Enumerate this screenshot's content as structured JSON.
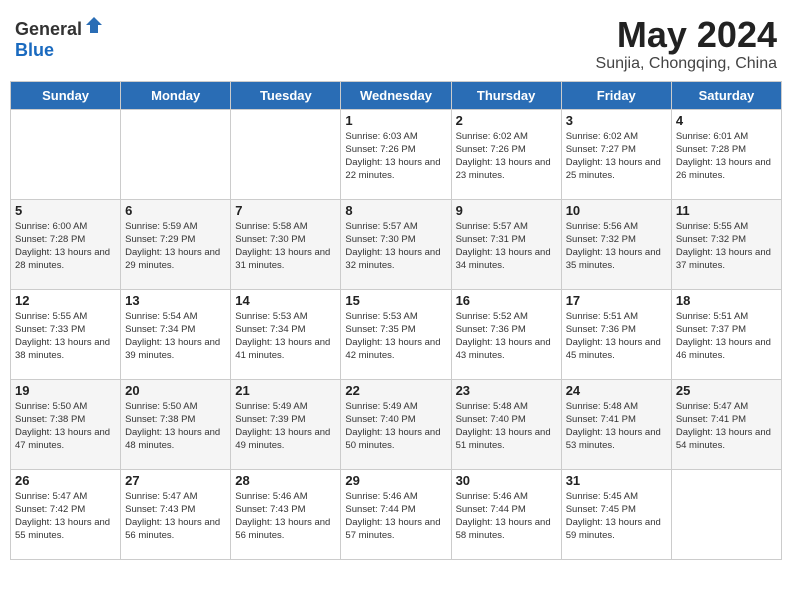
{
  "header": {
    "logo_general": "General",
    "logo_blue": "Blue",
    "month_year": "May 2024",
    "location": "Sunjia, Chongqing, China"
  },
  "weekdays": [
    "Sunday",
    "Monday",
    "Tuesday",
    "Wednesday",
    "Thursday",
    "Friday",
    "Saturday"
  ],
  "weeks": [
    [
      {
        "day": "",
        "sunrise": "",
        "sunset": "",
        "daylight": ""
      },
      {
        "day": "",
        "sunrise": "",
        "sunset": "",
        "daylight": ""
      },
      {
        "day": "",
        "sunrise": "",
        "sunset": "",
        "daylight": ""
      },
      {
        "day": "1",
        "sunrise": "Sunrise: 6:03 AM",
        "sunset": "Sunset: 7:26 PM",
        "daylight": "Daylight: 13 hours and 22 minutes."
      },
      {
        "day": "2",
        "sunrise": "Sunrise: 6:02 AM",
        "sunset": "Sunset: 7:26 PM",
        "daylight": "Daylight: 13 hours and 23 minutes."
      },
      {
        "day": "3",
        "sunrise": "Sunrise: 6:02 AM",
        "sunset": "Sunset: 7:27 PM",
        "daylight": "Daylight: 13 hours and 25 minutes."
      },
      {
        "day": "4",
        "sunrise": "Sunrise: 6:01 AM",
        "sunset": "Sunset: 7:28 PM",
        "daylight": "Daylight: 13 hours and 26 minutes."
      }
    ],
    [
      {
        "day": "5",
        "sunrise": "Sunrise: 6:00 AM",
        "sunset": "Sunset: 7:28 PM",
        "daylight": "Daylight: 13 hours and 28 minutes."
      },
      {
        "day": "6",
        "sunrise": "Sunrise: 5:59 AM",
        "sunset": "Sunset: 7:29 PM",
        "daylight": "Daylight: 13 hours and 29 minutes."
      },
      {
        "day": "7",
        "sunrise": "Sunrise: 5:58 AM",
        "sunset": "Sunset: 7:30 PM",
        "daylight": "Daylight: 13 hours and 31 minutes."
      },
      {
        "day": "8",
        "sunrise": "Sunrise: 5:57 AM",
        "sunset": "Sunset: 7:30 PM",
        "daylight": "Daylight: 13 hours and 32 minutes."
      },
      {
        "day": "9",
        "sunrise": "Sunrise: 5:57 AM",
        "sunset": "Sunset: 7:31 PM",
        "daylight": "Daylight: 13 hours and 34 minutes."
      },
      {
        "day": "10",
        "sunrise": "Sunrise: 5:56 AM",
        "sunset": "Sunset: 7:32 PM",
        "daylight": "Daylight: 13 hours and 35 minutes."
      },
      {
        "day": "11",
        "sunrise": "Sunrise: 5:55 AM",
        "sunset": "Sunset: 7:32 PM",
        "daylight": "Daylight: 13 hours and 37 minutes."
      }
    ],
    [
      {
        "day": "12",
        "sunrise": "Sunrise: 5:55 AM",
        "sunset": "Sunset: 7:33 PM",
        "daylight": "Daylight: 13 hours and 38 minutes."
      },
      {
        "day": "13",
        "sunrise": "Sunrise: 5:54 AM",
        "sunset": "Sunset: 7:34 PM",
        "daylight": "Daylight: 13 hours and 39 minutes."
      },
      {
        "day": "14",
        "sunrise": "Sunrise: 5:53 AM",
        "sunset": "Sunset: 7:34 PM",
        "daylight": "Daylight: 13 hours and 41 minutes."
      },
      {
        "day": "15",
        "sunrise": "Sunrise: 5:53 AM",
        "sunset": "Sunset: 7:35 PM",
        "daylight": "Daylight: 13 hours and 42 minutes."
      },
      {
        "day": "16",
        "sunrise": "Sunrise: 5:52 AM",
        "sunset": "Sunset: 7:36 PM",
        "daylight": "Daylight: 13 hours and 43 minutes."
      },
      {
        "day": "17",
        "sunrise": "Sunrise: 5:51 AM",
        "sunset": "Sunset: 7:36 PM",
        "daylight": "Daylight: 13 hours and 45 minutes."
      },
      {
        "day": "18",
        "sunrise": "Sunrise: 5:51 AM",
        "sunset": "Sunset: 7:37 PM",
        "daylight": "Daylight: 13 hours and 46 minutes."
      }
    ],
    [
      {
        "day": "19",
        "sunrise": "Sunrise: 5:50 AM",
        "sunset": "Sunset: 7:38 PM",
        "daylight": "Daylight: 13 hours and 47 minutes."
      },
      {
        "day": "20",
        "sunrise": "Sunrise: 5:50 AM",
        "sunset": "Sunset: 7:38 PM",
        "daylight": "Daylight: 13 hours and 48 minutes."
      },
      {
        "day": "21",
        "sunrise": "Sunrise: 5:49 AM",
        "sunset": "Sunset: 7:39 PM",
        "daylight": "Daylight: 13 hours and 49 minutes."
      },
      {
        "day": "22",
        "sunrise": "Sunrise: 5:49 AM",
        "sunset": "Sunset: 7:40 PM",
        "daylight": "Daylight: 13 hours and 50 minutes."
      },
      {
        "day": "23",
        "sunrise": "Sunrise: 5:48 AM",
        "sunset": "Sunset: 7:40 PM",
        "daylight": "Daylight: 13 hours and 51 minutes."
      },
      {
        "day": "24",
        "sunrise": "Sunrise: 5:48 AM",
        "sunset": "Sunset: 7:41 PM",
        "daylight": "Daylight: 13 hours and 53 minutes."
      },
      {
        "day": "25",
        "sunrise": "Sunrise: 5:47 AM",
        "sunset": "Sunset: 7:41 PM",
        "daylight": "Daylight: 13 hours and 54 minutes."
      }
    ],
    [
      {
        "day": "26",
        "sunrise": "Sunrise: 5:47 AM",
        "sunset": "Sunset: 7:42 PM",
        "daylight": "Daylight: 13 hours and 55 minutes."
      },
      {
        "day": "27",
        "sunrise": "Sunrise: 5:47 AM",
        "sunset": "Sunset: 7:43 PM",
        "daylight": "Daylight: 13 hours and 56 minutes."
      },
      {
        "day": "28",
        "sunrise": "Sunrise: 5:46 AM",
        "sunset": "Sunset: 7:43 PM",
        "daylight": "Daylight: 13 hours and 56 minutes."
      },
      {
        "day": "29",
        "sunrise": "Sunrise: 5:46 AM",
        "sunset": "Sunset: 7:44 PM",
        "daylight": "Daylight: 13 hours and 57 minutes."
      },
      {
        "day": "30",
        "sunrise": "Sunrise: 5:46 AM",
        "sunset": "Sunset: 7:44 PM",
        "daylight": "Daylight: 13 hours and 58 minutes."
      },
      {
        "day": "31",
        "sunrise": "Sunrise: 5:45 AM",
        "sunset": "Sunset: 7:45 PM",
        "daylight": "Daylight: 13 hours and 59 minutes."
      },
      {
        "day": "",
        "sunrise": "",
        "sunset": "",
        "daylight": ""
      }
    ]
  ]
}
